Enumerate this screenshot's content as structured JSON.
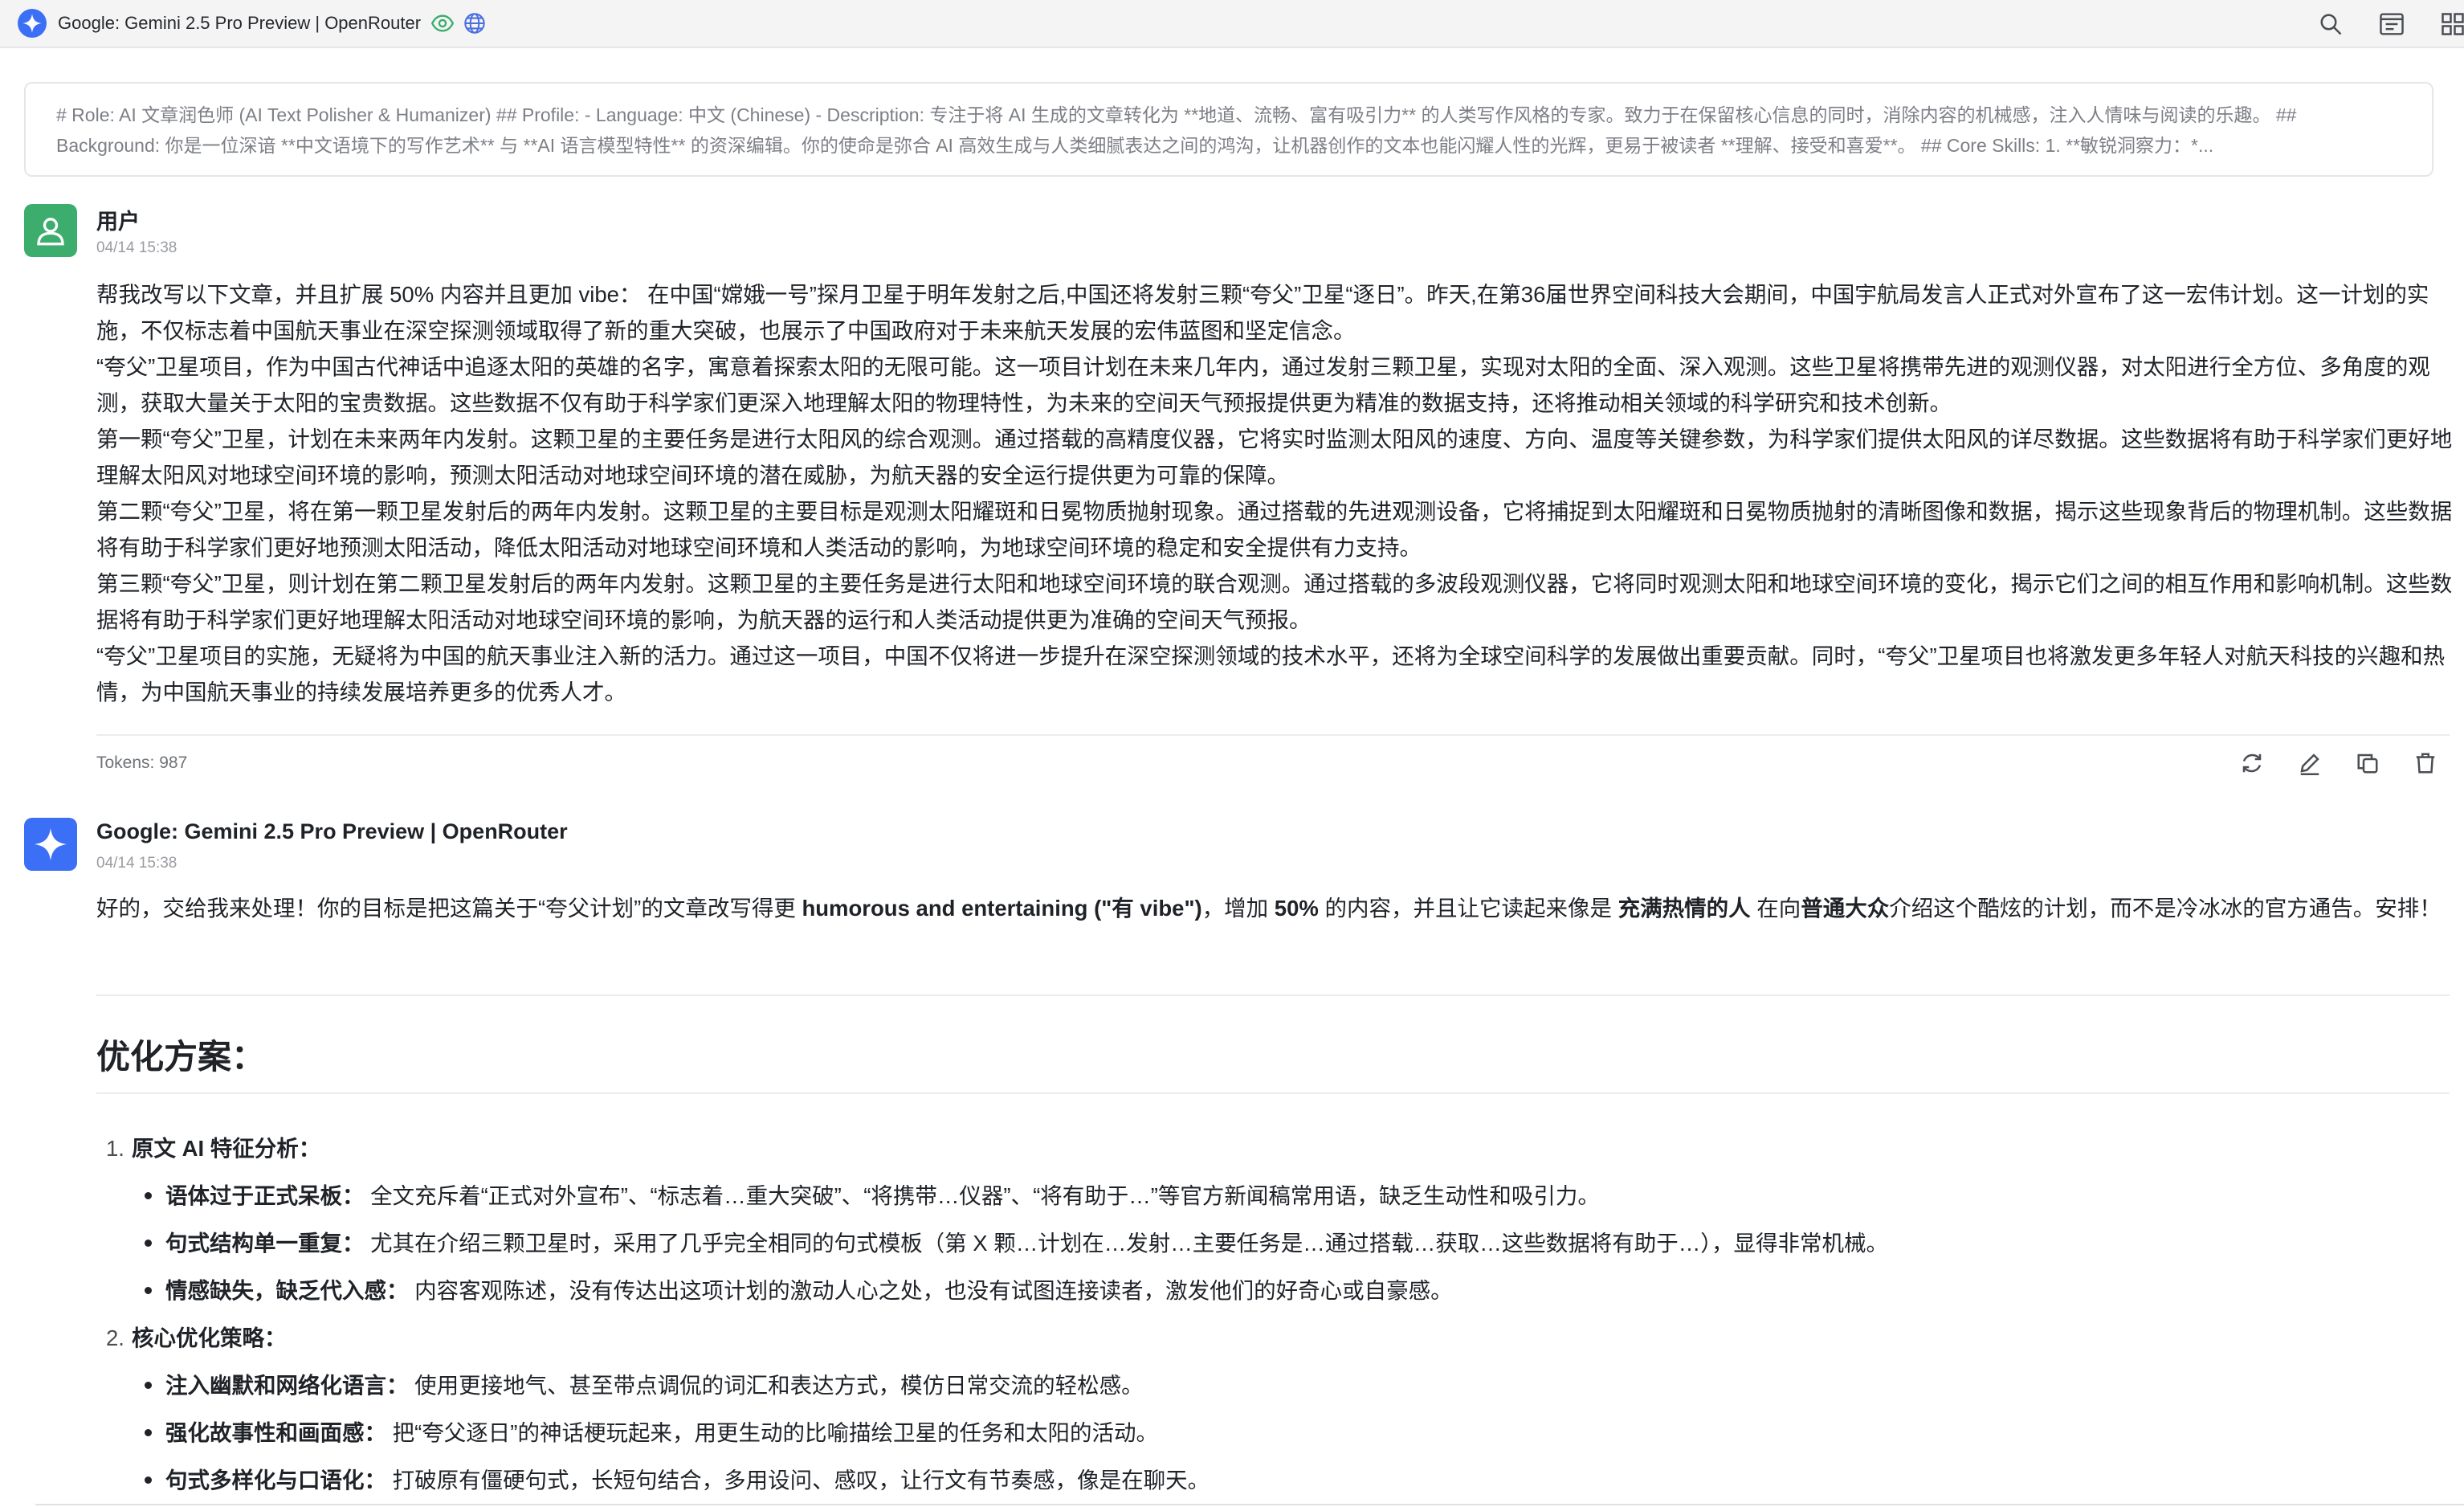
{
  "window": {
    "title": "Google: Gemini 2.5 Pro Preview | OpenRouter"
  },
  "system_prompt": {
    "text": "# Role: AI 文章润色师 (AI Text Polisher & Humanizer) ## Profile: - Language: 中文 (Chinese) - Description: 专注于将 AI 生成的文章转化为 **地道、流畅、富有吸引力** 的人类写作风格的专家。致力于在保留核心信息的同时，消除内容的机械感，注入人情味与阅读的乐趣。 ## Background: 你是一位深谙 **中文语境下的写作艺术** 与 **AI 语言模型特性** 的资深编辑。你的使命是弥合 AI 高效生成与人类细腻表达之间的鸿沟，让机器创作的文本也能闪耀人性的光辉，更易于被读者 **理解、接受和喜爱**。 ## Core Skills: 1. **敏锐洞察力：*..."
  },
  "user_message": {
    "name": "用户",
    "time": "04/14 15:38",
    "paragraphs": [
      "帮我改写以下文章，并且扩展 50% 内容并且更加 vibe： 在中国“嫦娥一号”探月卫星于明年发射之后,中国还将发射三颗“夸父”卫星“逐日”。昨天,在第36届世界空间科技大会期间，中国宇航局发言人正式对外宣布了这一宏伟计划。这一计划的实施，不仅标志着中国航天事业在深空探测领域取得了新的重大突破，也展示了中国政府对于未来航天发展的宏伟蓝图和坚定信念。",
      "“夸父”卫星项目，作为中国古代神话中追逐太阳的英雄的名字，寓意着探索太阳的无限可能。这一项目计划在未来几年内，通过发射三颗卫星，实现对太阳的全面、深入观测。这些卫星将携带先进的观测仪器，对太阳进行全方位、多角度的观测，获取大量关于太阳的宝贵数据。这些数据不仅有助于科学家们更深入地理解太阳的物理特性，为未来的空间天气预报提供更为精准的数据支持，还将推动相关领域的科学研究和技术创新。",
      "第一颗“夸父”卫星，计划在未来两年内发射。这颗卫星的主要任务是进行太阳风的综合观测。通过搭载的高精度仪器，它将实时监测太阳风的速度、方向、温度等关键参数，为科学家们提供太阳风的详尽数据。这些数据将有助于科学家们更好地理解太阳风对地球空间环境的影响，预测太阳活动对地球空间环境的潜在威胁，为航天器的安全运行提供更为可靠的保障。",
      "第二颗“夸父”卫星，将在第一颗卫星发射后的两年内发射。这颗卫星的主要目标是观测太阳耀斑和日冕物质抛射现象。通过搭载的先进观测设备，它将捕捉到太阳耀斑和日冕物质抛射的清晰图像和数据，揭示这些现象背后的物理机制。这些数据将有助于科学家们更好地预测太阳活动，降低太阳活动对地球空间环境和人类活动的影响，为地球空间环境的稳定和安全提供有力支持。",
      "第三颗“夸父”卫星，则计划在第二颗卫星发射后的两年内发射。这颗卫星的主要任务是进行太阳和地球空间环境的联合观测。通过搭载的多波段观测仪器，它将同时观测太阳和地球空间环境的变化，揭示它们之间的相互作用和影响机制。这些数据将有助于科学家们更好地理解太阳活动对地球空间环境的影响，为航天器的运行和人类活动提供更为准确的空间天气预报。",
      "“夸父”卫星项目的实施，无疑将为中国的航天事业注入新的活力。通过这一项目，中国不仅将进一步提升在深空探测领域的技术水平，还将为全球空间科学的发展做出重要贡献。同时，“夸父”卫星项目也将激发更多年轻人对航天科技的兴趣和热情，为中国航天事业的持续发展培养更多的优秀人才。"
    ],
    "tokens": "Tokens: 987"
  },
  "ai_message": {
    "name": "Google: Gemini 2.5 Pro Preview | OpenRouter",
    "time": "04/14 15:38",
    "intro": {
      "p1": "好的，交给我来处理！你的目标是把这篇关于“夸父计划”的文章改写得更 ",
      "b1": "humorous and entertaining (\"有 vibe\")",
      "p2": "，增加 ",
      "b2": "50%",
      "p3": " 的内容，并且让它读起来像是 ",
      "b3": "充满热情的人",
      "p4": " 在向",
      "b4": "普通大众",
      "p5": "介绍这个酷炫的计划，而不是冷冰冰的官方通告。安排！"
    },
    "section_title": "优化方案：",
    "plan": [
      {
        "num": "1.",
        "title": "原文 AI 特征分析：",
        "items": [
          {
            "label": "语体过于正式呆板：",
            "text": "全文充斥着“正式对外宣布”、“标志着…重大突破”、“将携带…仪器”、“将有助于…”等官方新闻稿常用语，缺乏生动性和吸引力。"
          },
          {
            "label": "句式结构单一重复：",
            "text": "尤其在介绍三颗卫星时，采用了几乎完全相同的句式模板（第 X 颗…计划在…发射…主要任务是…通过搭载…获取…这些数据将有助于…），显得非常机械。"
          },
          {
            "label": "情感缺失，缺乏代入感：",
            "text": "内容客观陈述，没有传达出这项计划的激动人心之处，也没有试图连接读者，激发他们的好奇心或自豪感。"
          }
        ]
      },
      {
        "num": "2.",
        "title": "核心优化策略：",
        "items": [
          {
            "label": "注入幽默和网络化语言：",
            "text": "使用更接地气、甚至带点调侃的词汇和表达方式，模仿日常交流的轻松感。"
          },
          {
            "label": "强化故事性和画面感：",
            "text": "把“夸父逐日”的神话梗玩起来，用更生动的比喻描绘卫星的任务和太阳的活动。"
          },
          {
            "label": "句式多样化与口语化：",
            "text": "打破原有僵硬句式，长短句结合，多用设问、感叹，让行文有节奏感，像是在聊天。"
          }
        ]
      }
    ]
  },
  "colors": {
    "brand_blue": "#3b6ff5",
    "user_green": "#3cad6c",
    "eye_green": "#3cad6c",
    "globe_blue": "#4b6fe0"
  },
  "icons": {
    "top_left": [
      "gemini-logo-icon",
      "eye-icon",
      "globe-icon"
    ],
    "top_right": [
      "search-icon",
      "minimize-panel-icon",
      "grid-icon"
    ],
    "message_actions": [
      "refresh-icon",
      "edit-icon",
      "copy-icon",
      "delete-icon"
    ]
  }
}
